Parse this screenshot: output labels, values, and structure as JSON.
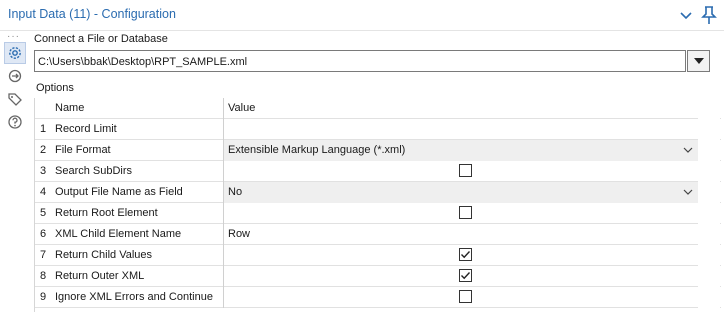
{
  "titlebar": {
    "title": "Input Data (11) - Configuration",
    "chevron_icon": "chevron-down-icon",
    "pin_icon": "pin-icon",
    "accent": "#2b6cb0"
  },
  "sidebar": {
    "dots": "···",
    "items": [
      {
        "icon": "gear-icon"
      },
      {
        "icon": "arrows-refresh-icon"
      },
      {
        "icon": "tag-icon"
      },
      {
        "icon": "help-icon"
      }
    ]
  },
  "connect": {
    "label": "Connect a File or Database",
    "path": "C:\\Users\\bbak\\Desktop\\RPT_SAMPLE.xml"
  },
  "options": {
    "label": "Options",
    "headers": {
      "name": "Name",
      "value": "Value"
    },
    "rows": [
      {
        "num": "1",
        "name": "Record Limit",
        "type": "text",
        "value": ""
      },
      {
        "num": "2",
        "name": "File Format",
        "type": "dropdown",
        "value": "Extensible Markup Language (*.xml)"
      },
      {
        "num": "3",
        "name": "Search SubDirs",
        "type": "checkbox",
        "checked": false
      },
      {
        "num": "4",
        "name": "Output File Name as Field",
        "type": "dropdown",
        "value": "No"
      },
      {
        "num": "5",
        "name": "Return Root Element",
        "type": "checkbox",
        "checked": false
      },
      {
        "num": "6",
        "name": "XML Child Element Name",
        "type": "text",
        "value": "Row"
      },
      {
        "num": "7",
        "name": "Return Child Values",
        "type": "checkbox",
        "checked": true
      },
      {
        "num": "8",
        "name": "Return Outer XML",
        "type": "checkbox",
        "checked": true
      },
      {
        "num": "9",
        "name": "Ignore XML Errors and Continue",
        "type": "checkbox",
        "checked": false
      }
    ]
  }
}
